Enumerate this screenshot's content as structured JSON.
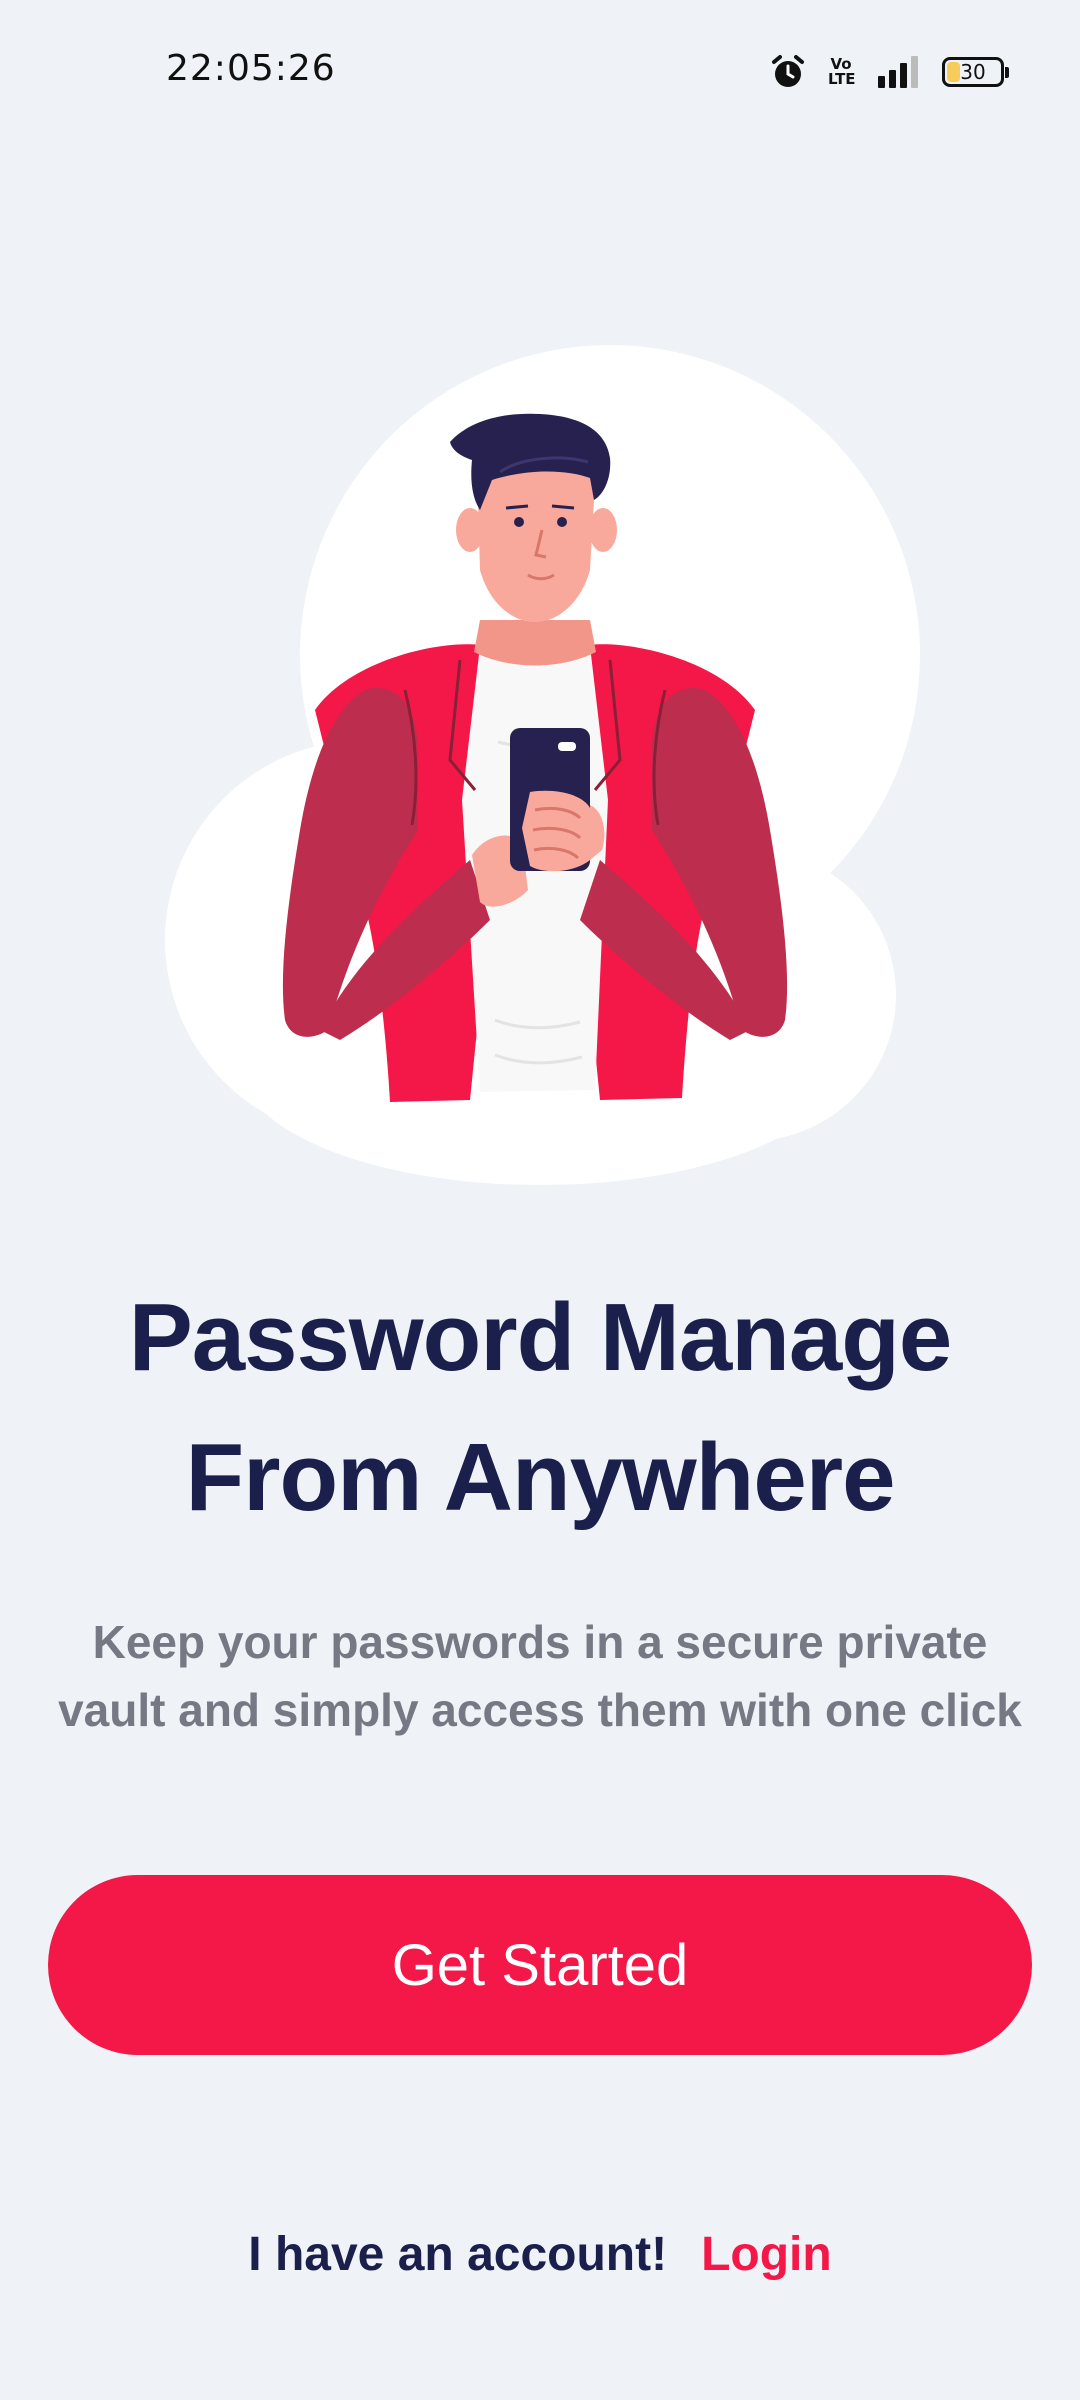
{
  "status_bar": {
    "time": "22:05:26",
    "network_label_top": "Vo",
    "network_label_bottom": "LTE",
    "battery_level": "30",
    "battery_fill_fraction": 0.3,
    "icons": [
      "alarm-icon",
      "volte-icon",
      "signal-icon",
      "battery-icon"
    ]
  },
  "hero": {
    "illustration": "man-holding-phone-illustration"
  },
  "title": {
    "line1": "Password Manage",
    "line2": "From Anywhere"
  },
  "subtitle": {
    "line1": "Keep your passwords in a secure private",
    "line2": "vault and simply access them with one click"
  },
  "actions": {
    "get_started_label": "Get Started",
    "account_prompt": "I have an account!",
    "login_label": "Login"
  },
  "colors": {
    "background": "#eff2f6",
    "accent": "#f31848",
    "heading": "#1a1f4b",
    "body_text": "#767884"
  }
}
